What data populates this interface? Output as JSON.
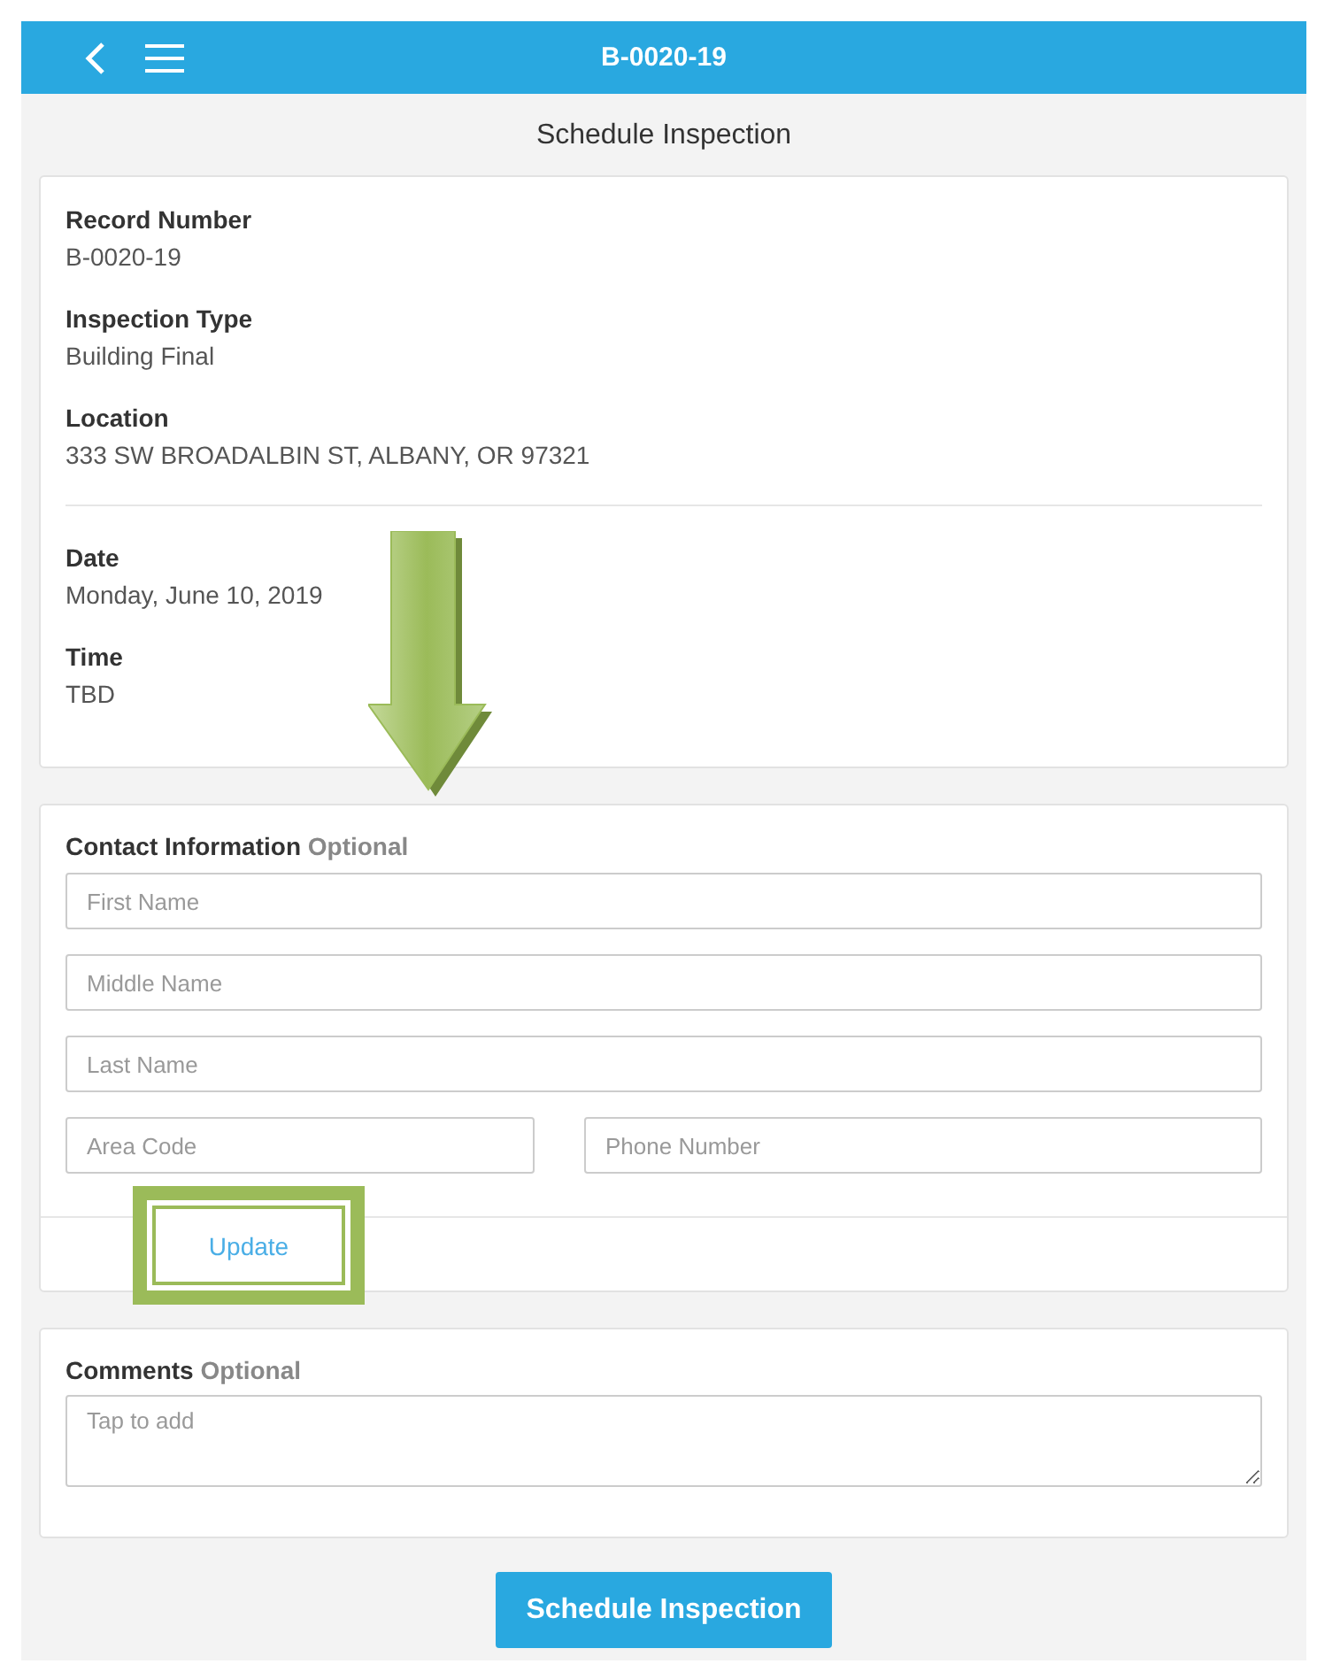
{
  "header": {
    "title": "B-0020-19"
  },
  "page_title": "Schedule Inspection",
  "record_details": [
    {
      "label": "Record Number",
      "value": "B-0020-19"
    },
    {
      "label": "Inspection Type",
      "value": "Building Final"
    },
    {
      "label": "Location",
      "value": "333 SW BROADALBIN ST, ALBANY, OR 97321"
    }
  ],
  "schedule_details": [
    {
      "label": "Date",
      "value": "Monday, June 10, 2019"
    },
    {
      "label": "Time",
      "value": "TBD"
    }
  ],
  "contact": {
    "title": "Contact Information",
    "optional": "Optional",
    "rows": [
      [
        {
          "placeholder": "First Name"
        }
      ],
      [
        {
          "placeholder": "Middle Name"
        }
      ],
      [
        {
          "placeholder": "Last Name"
        }
      ],
      [
        {
          "placeholder": "Area Code"
        },
        {
          "placeholder": "Phone Number"
        }
      ]
    ],
    "update_button": "Update"
  },
  "comments": {
    "title": "Comments",
    "optional": "Optional",
    "placeholder": "Tap to add"
  },
  "submit_button": "Schedule Inspection"
}
